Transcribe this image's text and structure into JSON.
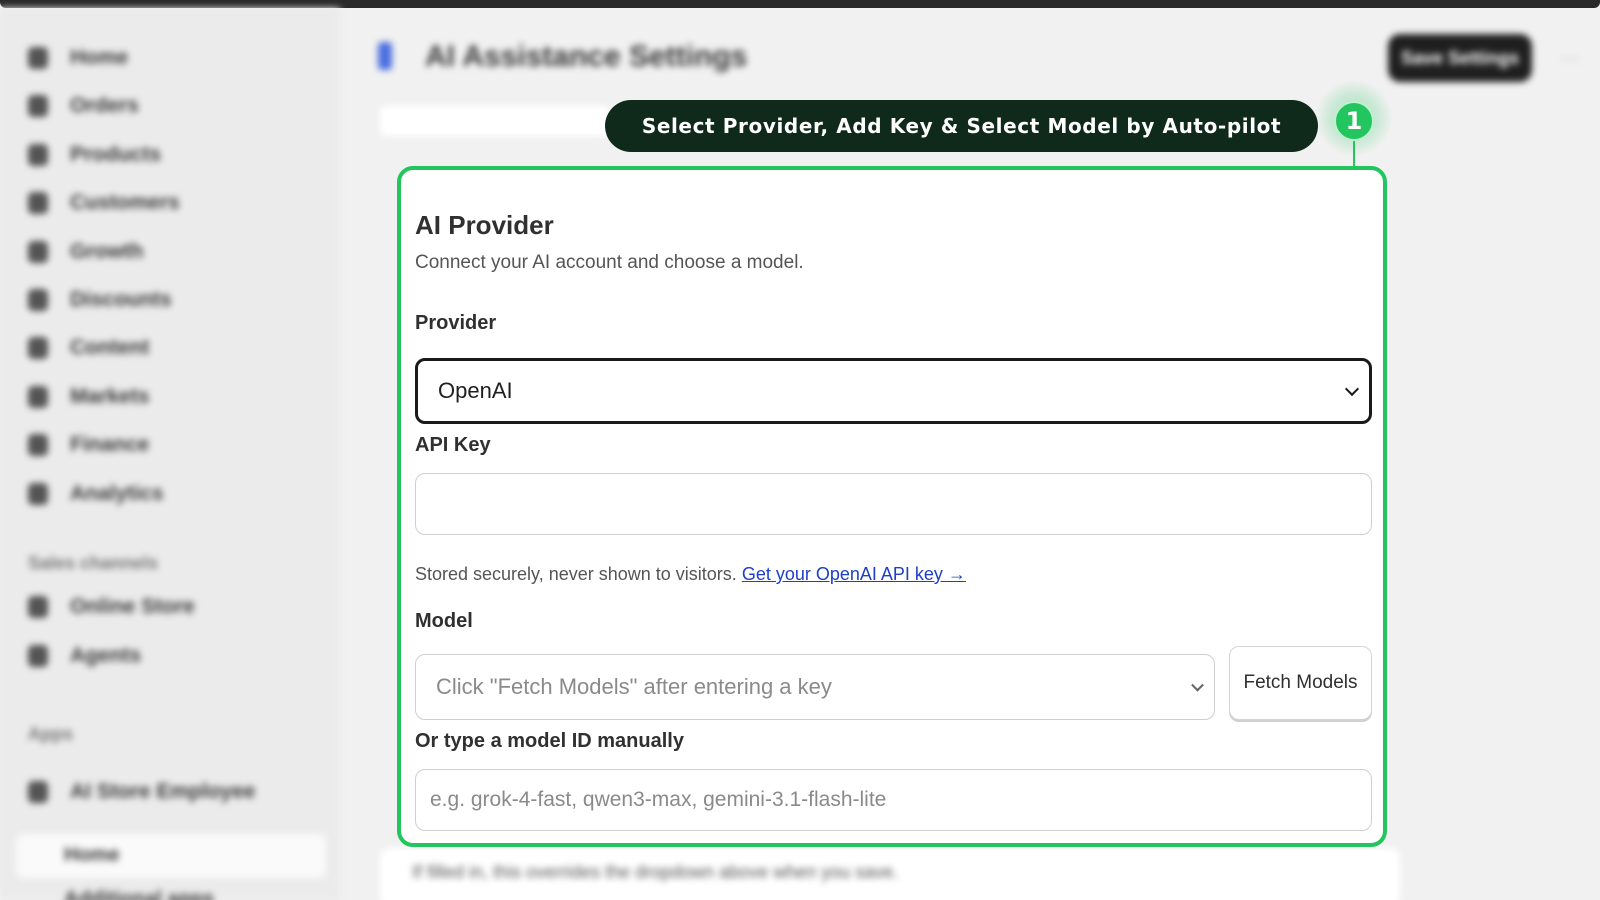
{
  "background": {
    "page_title": "AI Assistance Settings",
    "save_label": "Save Settings",
    "sidebar": {
      "items": [
        "Home",
        "Orders",
        "Products",
        "Customers",
        "Growth",
        "Discounts",
        "Content",
        "Markets",
        "Finance",
        "Analytics"
      ],
      "sales_channels_label": "Sales channels",
      "sales_channels": [
        "Online Store",
        "Agents"
      ],
      "apps_label": "Apps",
      "app_name": "AI Store Employee",
      "app_subitems": [
        "Home",
        "Additional apps"
      ]
    },
    "below_card_text": "If filled in, this overrides the dropdown above when you save."
  },
  "guide": {
    "text": "Select Provider, Add Key & Select Model by Auto-pilot",
    "step": "1",
    "accent_color": "#22c55e",
    "pill_color": "#0f2a1a"
  },
  "card": {
    "title": "AI Provider",
    "description": "Connect your AI account and choose a model.",
    "provider": {
      "label": "Provider",
      "value": "OpenAI"
    },
    "api_key": {
      "label": "API Key",
      "value": "",
      "help_text": "Stored securely, never shown to visitors.",
      "help_link": "Get your OpenAI API key →",
      "link_color": "#1f3ec9"
    },
    "model": {
      "label": "Model",
      "placeholder": "Click \"Fetch Models\" after entering a key",
      "fetch_label": "Fetch Models"
    },
    "manual_model": {
      "label": "Or type a model ID manually",
      "placeholder": "e.g. grok-4-fast, qwen3-max, gemini-3.1-flash-lite"
    }
  }
}
